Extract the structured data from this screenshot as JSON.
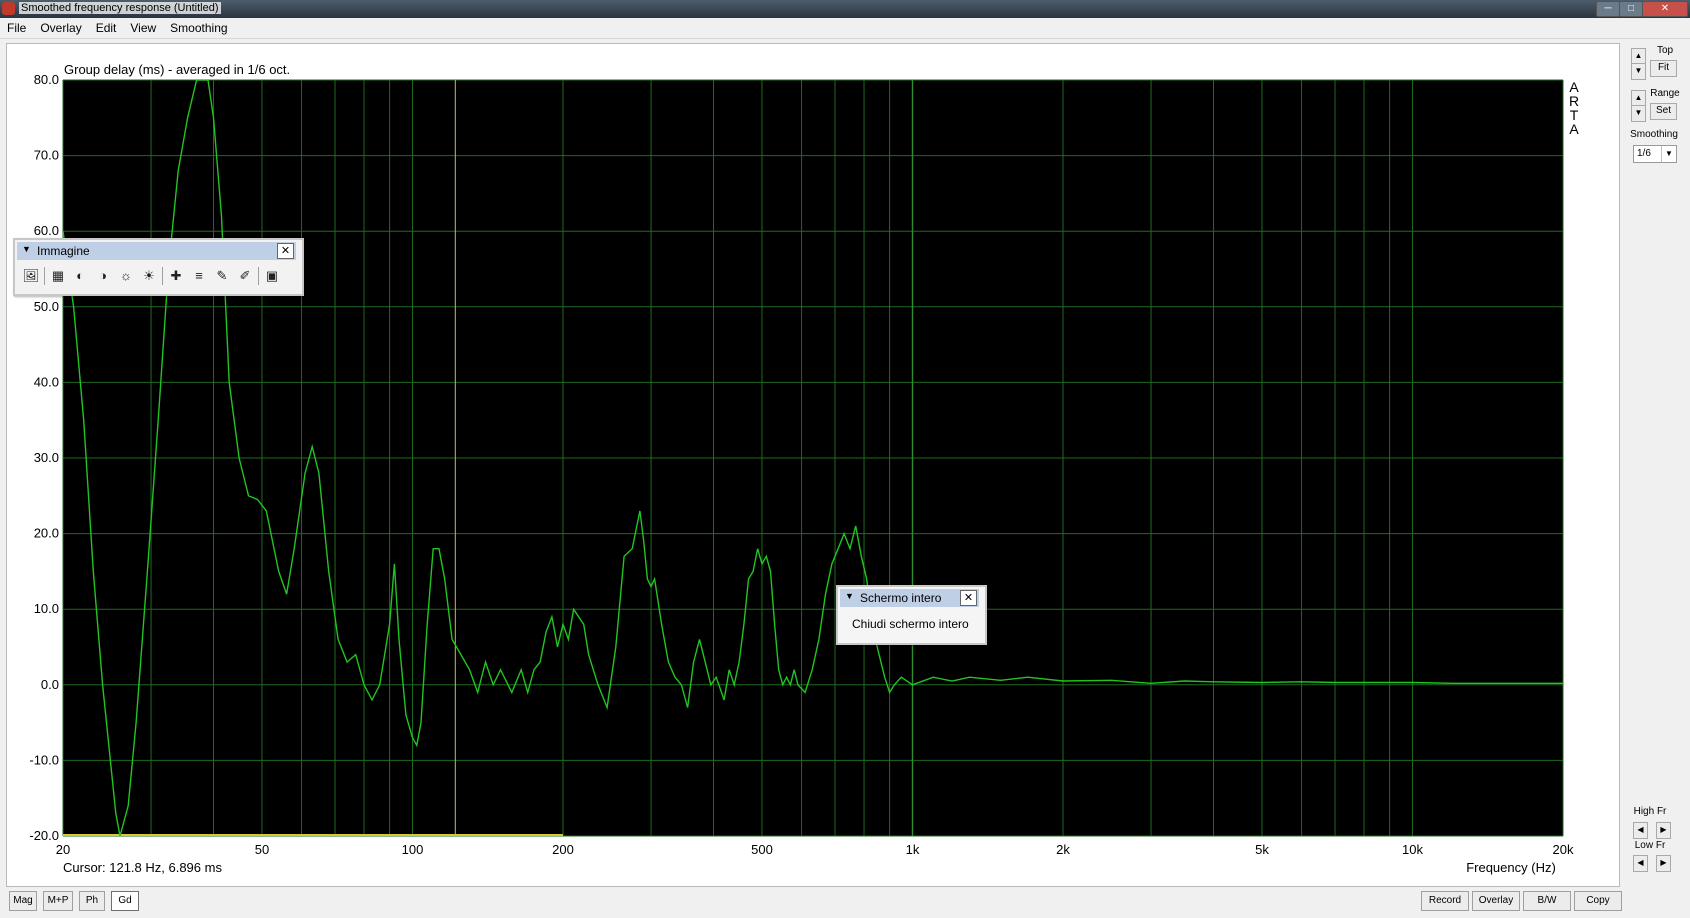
{
  "window": {
    "title": "Smoothed frequency response (Untitled)",
    "controls": [
      "─",
      "□",
      "✕"
    ]
  },
  "menu": [
    "File",
    "Overlay",
    "Edit",
    "View",
    "Smoothing"
  ],
  "side_panel": {
    "top_label": "Top",
    "fit_label": "Fit",
    "range_label": "Range",
    "set_label": "Set",
    "smoothing_label": "Smoothing",
    "smoothing_value": "1/6",
    "high_fr_label": "High Fr",
    "low_fr_label": "Low Fr",
    "arrow_up": "▲",
    "arrow_down": "▼",
    "arrow_left": "◀",
    "arrow_right": "▶",
    "dropdown": "▼"
  },
  "chart_data": {
    "type": "line",
    "title": "Group delay (ms) - averaged in 1/6 oct.",
    "xlabel": "Frequency (Hz)",
    "ylabel": "",
    "x_scale": "log",
    "xlim": [
      20,
      20000
    ],
    "ylim": [
      -20,
      80
    ],
    "y_ticks": [
      "80.0",
      "70.0",
      "60.0",
      "50.0",
      "40.0",
      "30.0",
      "20.0",
      "10.0",
      "0.0",
      "-10.0",
      "-20.0"
    ],
    "x_ticks": [
      {
        "value": 20,
        "label": "20"
      },
      {
        "value": 50,
        "label": "50"
      },
      {
        "value": 100,
        "label": "100"
      },
      {
        "value": 200,
        "label": "200"
      },
      {
        "value": 500,
        "label": "500"
      },
      {
        "value": 1000,
        "label": "1k"
      },
      {
        "value": 2000,
        "label": "2k"
      },
      {
        "value": 5000,
        "label": "5k"
      },
      {
        "value": 10000,
        "label": "10k"
      },
      {
        "value": 20000,
        "label": "20k"
      }
    ],
    "grid": true,
    "cursor": {
      "freq": 121.8,
      "text": "Cursor: 121.8 Hz, 6.896 ms"
    },
    "watermark": [
      "A",
      "R",
      "T",
      "A"
    ],
    "series": [
      {
        "color": "#22c422",
        "points": [
          [
            20,
            60
          ],
          [
            21,
            50
          ],
          [
            22,
            35
          ],
          [
            23,
            15
          ],
          [
            24,
            0
          ],
          [
            25.5,
            -17
          ],
          [
            26,
            -20
          ],
          [
            27,
            -16
          ],
          [
            28,
            -5
          ],
          [
            29.5,
            15
          ],
          [
            31,
            35
          ],
          [
            32.5,
            55
          ],
          [
            34,
            68
          ],
          [
            35.5,
            75
          ],
          [
            37,
            80
          ],
          [
            39,
            80
          ],
          [
            40,
            75
          ],
          [
            41.5,
            62
          ],
          [
            43,
            40
          ],
          [
            45,
            30
          ],
          [
            47,
            25
          ],
          [
            49,
            24.5
          ],
          [
            51,
            23
          ],
          [
            54,
            15
          ],
          [
            56,
            12
          ],
          [
            58,
            18
          ],
          [
            61,
            28
          ],
          [
            63,
            31.5
          ],
          [
            65,
            28
          ],
          [
            68,
            15
          ],
          [
            71,
            6
          ],
          [
            74,
            3
          ],
          [
            77,
            4
          ],
          [
            80,
            0
          ],
          [
            83,
            -2
          ],
          [
            86,
            0
          ],
          [
            90,
            8
          ],
          [
            92,
            16
          ],
          [
            94,
            6
          ],
          [
            97,
            -4
          ],
          [
            100,
            -7
          ],
          [
            102,
            -8
          ],
          [
            104,
            -5
          ],
          [
            107,
            8
          ],
          [
            110,
            18
          ],
          [
            113,
            18
          ],
          [
            116,
            14
          ],
          [
            120,
            6
          ],
          [
            125,
            4
          ],
          [
            130,
            2
          ],
          [
            135,
            -1
          ],
          [
            140,
            3
          ],
          [
            145,
            0
          ],
          [
            150,
            2
          ],
          [
            158,
            -1
          ],
          [
            165,
            2
          ],
          [
            170,
            -1
          ],
          [
            175,
            2
          ],
          [
            180,
            3
          ],
          [
            185,
            7
          ],
          [
            190,
            9
          ],
          [
            195,
            5
          ],
          [
            200,
            8
          ],
          [
            205,
            6
          ],
          [
            210,
            10
          ],
          [
            220,
            8
          ],
          [
            225,
            4
          ],
          [
            235,
            0
          ],
          [
            245,
            -3
          ],
          [
            255,
            5
          ],
          [
            265,
            17
          ],
          [
            275,
            18
          ],
          [
            285,
            23
          ],
          [
            290,
            19
          ],
          [
            295,
            14
          ],
          [
            300,
            13
          ],
          [
            305,
            14
          ],
          [
            315,
            8
          ],
          [
            325,
            3
          ],
          [
            335,
            1
          ],
          [
            345,
            0
          ],
          [
            355,
            -3
          ],
          [
            365,
            3
          ],
          [
            375,
            6
          ],
          [
            385,
            3
          ],
          [
            395,
            0
          ],
          [
            405,
            1
          ],
          [
            420,
            -2
          ],
          [
            430,
            2
          ],
          [
            440,
            0
          ],
          [
            450,
            3
          ],
          [
            460,
            8
          ],
          [
            470,
            14
          ],
          [
            480,
            15
          ],
          [
            490,
            18
          ],
          [
            500,
            16
          ],
          [
            510,
            17
          ],
          [
            520,
            15
          ],
          [
            530,
            8
          ],
          [
            540,
            2
          ],
          [
            550,
            0
          ],
          [
            560,
            1
          ],
          [
            570,
            0
          ],
          [
            580,
            2
          ],
          [
            590,
            0
          ],
          [
            610,
            -1
          ],
          [
            630,
            2
          ],
          [
            650,
            6
          ],
          [
            670,
            12
          ],
          [
            690,
            16
          ],
          [
            710,
            18
          ],
          [
            730,
            20
          ],
          [
            750,
            18
          ],
          [
            770,
            21
          ],
          [
            790,
            17
          ],
          [
            810,
            14
          ],
          [
            830,
            8
          ],
          [
            850,
            5
          ],
          [
            880,
            1
          ],
          [
            900,
            -1
          ],
          [
            920,
            0
          ],
          [
            950,
            1
          ],
          [
            1000,
            0
          ],
          [
            1100,
            1
          ],
          [
            1200,
            0.5
          ],
          [
            1300,
            1
          ],
          [
            1500,
            0.6
          ],
          [
            1700,
            1
          ],
          [
            2000,
            0.5
          ],
          [
            2500,
            0.6
          ],
          [
            3000,
            0.2
          ],
          [
            3500,
            0.5
          ],
          [
            4000,
            0.4
          ],
          [
            5000,
            0.3
          ],
          [
            6000,
            0.4
          ],
          [
            7000,
            0.3
          ],
          [
            8000,
            0.3
          ],
          [
            10000,
            0.3
          ],
          [
            12000,
            0.2
          ],
          [
            15000,
            0.2
          ],
          [
            20000,
            0.2
          ]
        ]
      }
    ]
  },
  "image_toolbar": {
    "title": "Immagine",
    "close": "✕",
    "collapse": "▼",
    "icons": [
      "🖼",
      "▦",
      "◐",
      "◑",
      "☼",
      "☀",
      "✚",
      "≡",
      "✎",
      "✐",
      "▣"
    ]
  },
  "fullscreen_toolbar": {
    "title": "Schermo intero",
    "command": "Chiudi schermo intero",
    "close": "✕",
    "collapse": "▼"
  },
  "bottom_tabs": [
    {
      "label": "Mag",
      "active": false
    },
    {
      "label": "M+P",
      "active": false
    },
    {
      "label": "Ph",
      "active": false
    },
    {
      "label": "Gd",
      "active": true
    }
  ],
  "bottom_buttons": [
    "Record",
    "Overlay",
    "B/W",
    "Copy"
  ]
}
